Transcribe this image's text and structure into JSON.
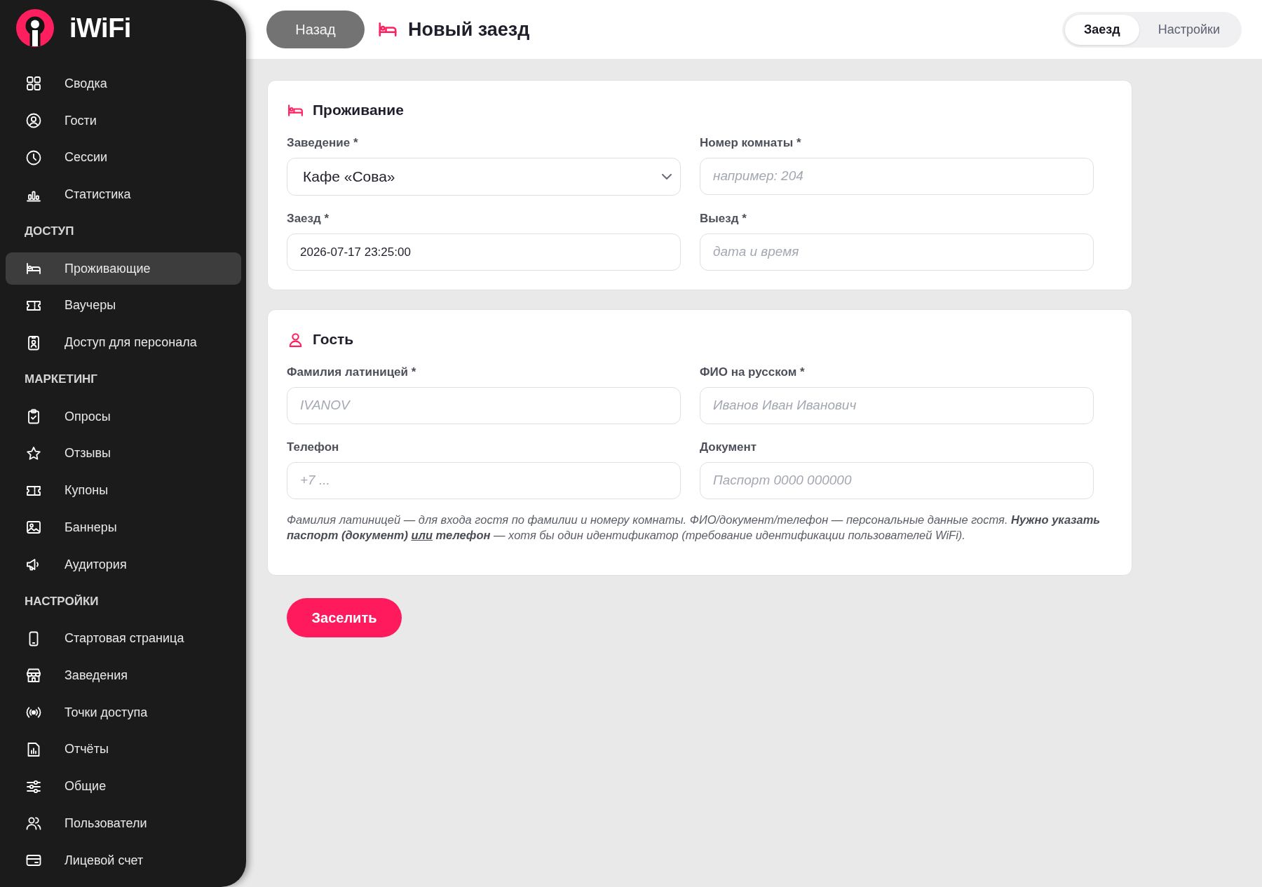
{
  "sidebar": {
    "brand": "iWiFi",
    "groups": [
      {
        "items": [
          {
            "label": "Сводка",
            "selected": false
          },
          {
            "label": "Гости",
            "selected": false
          },
          {
            "label": "Сессии",
            "selected": false
          },
          {
            "label": "Статистика",
            "selected": false
          }
        ]
      },
      {
        "title": "ДОСТУП",
        "items": [
          {
            "label": "Проживающие",
            "selected": true
          },
          {
            "label": "Ваучеры",
            "selected": false
          },
          {
            "label": "Доступ для персонала",
            "selected": false
          }
        ]
      },
      {
        "title": "МАРКЕТИНГ",
        "items": [
          {
            "label": "Опросы",
            "selected": false
          },
          {
            "label": "Отзывы",
            "selected": false
          },
          {
            "label": "Купоны",
            "selected": false
          },
          {
            "label": "Баннеры",
            "selected": false
          },
          {
            "label": "Аудитория",
            "selected": false
          }
        ]
      },
      {
        "title": "НАСТРОЙКИ",
        "items": [
          {
            "label": "Стартовая страница",
            "selected": false
          },
          {
            "label": "Заведения",
            "selected": false
          },
          {
            "label": "Точки доступа",
            "selected": false
          },
          {
            "label": "Отчёты",
            "selected": false
          },
          {
            "label": "Общие",
            "selected": false
          },
          {
            "label": "Пользователи",
            "selected": false
          },
          {
            "label": "Лицевой счет",
            "selected": false
          }
        ]
      }
    ]
  },
  "header": {
    "back_button": "Назад",
    "title": "Новый заезд",
    "tabs": [
      {
        "label": "Заезд",
        "selected": true
      },
      {
        "label": "Настройки",
        "selected": false
      }
    ]
  },
  "sections": [
    {
      "kind": "stay",
      "title": "Проживание",
      "fields": [
        {
          "kind": "select",
          "label": "Заведение *",
          "value": "Кафе «Сова»"
        },
        {
          "kind": "text",
          "label": "Номер комнаты *",
          "placeholder": "например: 204"
        },
        {
          "kind": "text",
          "label": "Заезд *",
          "value": "2026-07-17 23:25:00"
        },
        {
          "kind": "text",
          "label": "Выезд *",
          "placeholder": "дата и время"
        }
      ]
    },
    {
      "kind": "guest",
      "title": "Гость",
      "fields": [
        {
          "kind": "text",
          "label": "Фамилия латиницей *",
          "placeholder": "IVANOV"
        },
        {
          "kind": "text",
          "label": "ФИО на русском *",
          "placeholder": "Иванов Иван Иванович"
        },
        {
          "kind": "text",
          "label": "Телефон",
          "placeholder": "+7 ..."
        },
        {
          "kind": "text",
          "label": "Документ",
          "placeholder": "Паспорт 0000 000000"
        }
      ],
      "note": [
        {
          "kind": "plain",
          "text": "Фамилия латиницей — для входа гостя по фамилии и номеру комнаты. ФИО/документ/телефон — персональные данные гостя. "
        },
        {
          "kind": "strong",
          "text": "Нужно указать паспорт (документ) "
        },
        {
          "kind": "underlined",
          "text": "или"
        },
        {
          "kind": "strong",
          "text": " телефон"
        },
        {
          "kind": "plain",
          "text": " — хотя бы один идентификатор (требование идентификации пользователей WiFi)."
        }
      ]
    }
  ],
  "submit_button": "Заселить"
}
